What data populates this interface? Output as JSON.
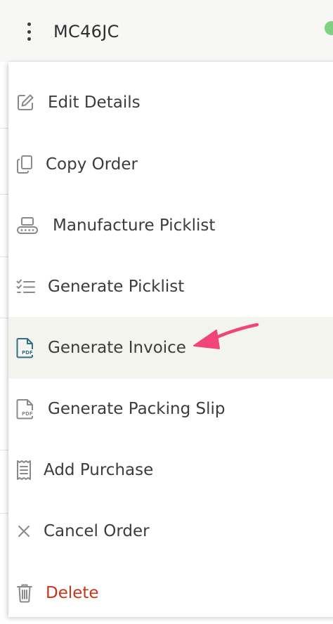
{
  "header": {
    "order_id": "MC46JC",
    "status_color": "#7ed17e"
  },
  "menu": {
    "items": [
      {
        "label": "Edit Details",
        "icon": "edit-icon"
      },
      {
        "label": "Copy Order",
        "icon": "copy-icon"
      },
      {
        "label": "Manufacture Picklist",
        "icon": "conveyor-icon"
      },
      {
        "label": "Generate Picklist",
        "icon": "checklist-icon"
      },
      {
        "label": "Generate Invoice",
        "icon": "pdf-file-icon",
        "highlighted": true
      },
      {
        "label": "Generate Packing Slip",
        "icon": "pdf-file-icon"
      },
      {
        "label": "Add Purchase",
        "icon": "receipt-icon"
      },
      {
        "label": "Cancel Order",
        "icon": "close-icon"
      },
      {
        "label": "Delete",
        "icon": "trash-icon",
        "color": "#c8341a"
      }
    ]
  },
  "annotation": {
    "arrow_color": "#f0457a",
    "points_to": "Generate Invoice"
  }
}
